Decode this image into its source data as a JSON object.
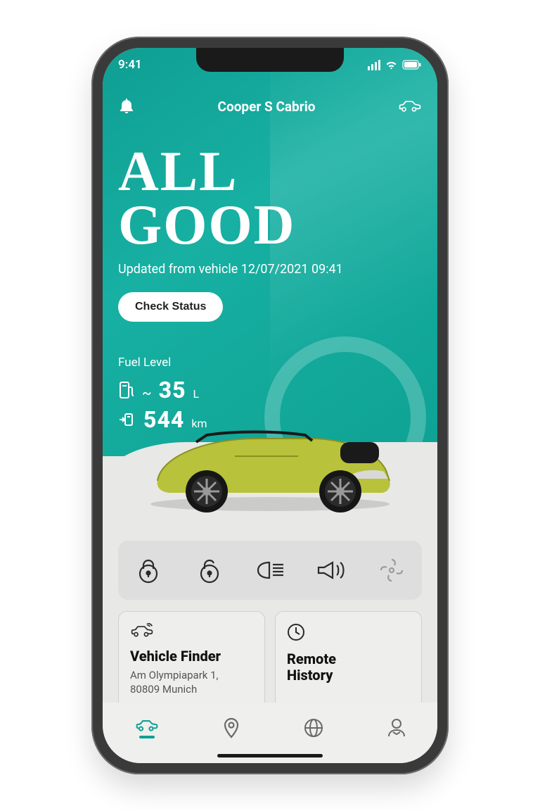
{
  "statusbar": {
    "time": "9:41"
  },
  "nav": {
    "title": "Cooper S Cabrio"
  },
  "hero": {
    "line1": "ALL",
    "line2": "GOOD",
    "updated_prefix": "Updated from vehicle ",
    "updated_value": "12/07/2021 09:41",
    "check_label": "Check Status"
  },
  "fuel": {
    "label": "Fuel Level",
    "tilde": "~",
    "liters_value": "35",
    "liters_unit": "L",
    "range_value": "544",
    "range_unit": "km"
  },
  "cards": {
    "finder": {
      "title": "Vehicle Finder",
      "line1": "Am Olympiapark 1,",
      "line2": "80809 Munich"
    },
    "history": {
      "title1": "Remote",
      "title2": "History"
    }
  },
  "colors": {
    "teal": "#0ea294"
  }
}
